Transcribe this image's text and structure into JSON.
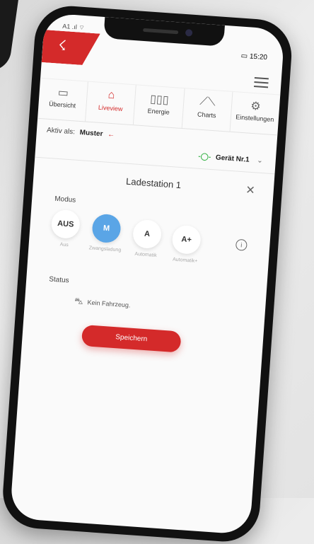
{
  "status_bar": {
    "carrier": "A1 .ıl ⌔",
    "time": "15:20"
  },
  "nav": [
    {
      "label": "Übersicht",
      "icon": "monitor-icon"
    },
    {
      "label": "Liveview",
      "icon": "home-icon"
    },
    {
      "label": "Energie",
      "icon": "bar-chart-icon"
    },
    {
      "label": "Charts",
      "icon": "line-chart-icon"
    },
    {
      "label": "Einstellungen",
      "icon": "gears-icon"
    }
  ],
  "active_as": {
    "label": "Aktiv als:",
    "user": "Muster"
  },
  "device": {
    "name": "Gerät Nr.1"
  },
  "card": {
    "title": "Ladestation 1"
  },
  "modus": {
    "label": "Modus",
    "options": [
      {
        "code": "AUS",
        "sub": "Aus"
      },
      {
        "code": "M",
        "sub": "Zwangsladung"
      },
      {
        "code": "A",
        "sub": "Automatik"
      },
      {
        "code": "A+",
        "sub": "Automatik+"
      }
    ],
    "selected": "M"
  },
  "status": {
    "label": "Status",
    "text": "Kein Fahrzeug."
  },
  "save_label": "Speichern",
  "colors": {
    "brand": "#d42a2a",
    "selected": "#5aa5e6",
    "plug": "#3cb44b"
  }
}
